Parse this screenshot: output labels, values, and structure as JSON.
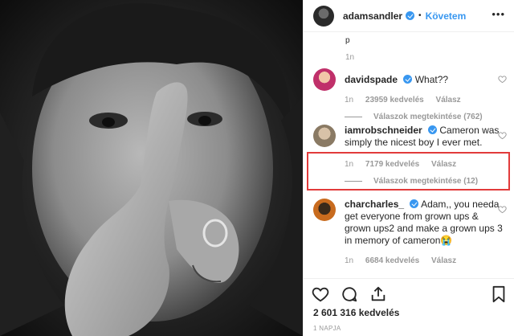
{
  "post": {
    "author": "adamsandler",
    "separator": "•",
    "follow_label": "Követem",
    "more_label": "•••"
  },
  "comments": {
    "prior_time": "1n",
    "prior_text": "p",
    "items": [
      {
        "username": "davidspade",
        "text": "What??",
        "time": "1n",
        "likes": "23959 kedvelés",
        "reply": "Válasz",
        "replies": "Válaszok megtekintése (762)",
        "avatar_color": "#c0306a"
      },
      {
        "username": "iamrobschneider",
        "text": "Cameron was simply the nicest boy I ever met.",
        "time": "1n",
        "likes": "7179 kedvelés",
        "reply": "Válasz",
        "replies": "Válaszok megtekintése (12)",
        "avatar_color": "#8a7a64"
      },
      {
        "username": "charcharles_",
        "text": "Adam,, you needa get everyone from grown ups & grown ups2 and make a grown ups 3 in memory of cameron😭",
        "time": "1n",
        "likes": "6684 kedvelés",
        "reply": "Válasz",
        "avatar_color": "#c86b1e"
      }
    ]
  },
  "actions": {
    "like_count": "2 601 316 kedvelés",
    "date": "1 NAPJA"
  },
  "colors": {
    "accent": "#3897f0",
    "highlight": "#e23b3b",
    "muted": "#999999"
  },
  "icons": [
    "heart-icon",
    "comment-icon",
    "share-icon",
    "bookmark-icon",
    "verified-badge-icon"
  ]
}
